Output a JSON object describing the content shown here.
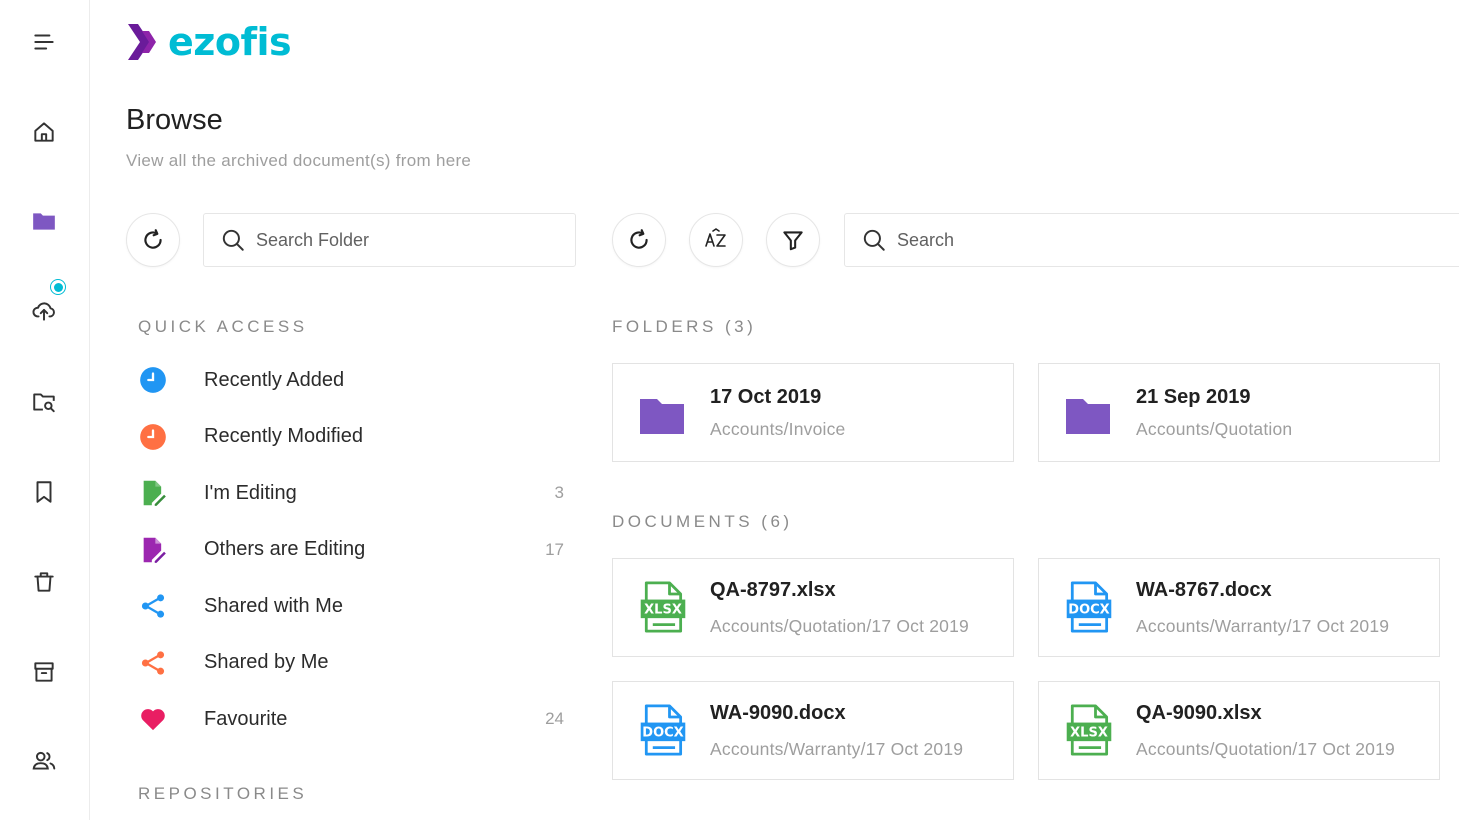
{
  "brand": {
    "logo_text": "ezofis"
  },
  "page": {
    "title": "Browse",
    "subtitle": "View all the archived document(s) from here"
  },
  "folder_search": {
    "placeholder": "Search Folder"
  },
  "main_search": {
    "placeholder": "Search"
  },
  "quick_access": {
    "heading": "QUICK ACCESS",
    "items": [
      {
        "label": "Recently Added",
        "count": "",
        "icon": "clock-icon",
        "color": "#2196f3"
      },
      {
        "label": "Recently Modified",
        "count": "",
        "icon": "clock-icon",
        "color": "#ff7043"
      },
      {
        "label": "I'm Editing",
        "count": "3",
        "icon": "edit-document-icon",
        "color": "#4caf50"
      },
      {
        "label": "Others are Editing",
        "count": "17",
        "icon": "edit-document-icon",
        "color": "#9c27b0"
      },
      {
        "label": "Shared with Me",
        "count": "",
        "icon": "share-icon",
        "color": "#2196f3"
      },
      {
        "label": "Shared by Me",
        "count": "",
        "icon": "share-icon",
        "color": "#ff7043"
      },
      {
        "label": "Favourite",
        "count": "24",
        "icon": "heart-icon",
        "color": "#e91e63"
      }
    ]
  },
  "repositories": {
    "heading": "REPOSITORIES"
  },
  "folders": {
    "heading": "FOLDERS (3)",
    "items": [
      {
        "name": "17 Oct 2019",
        "path": "Accounts/Invoice"
      },
      {
        "name": "21 Sep 2019",
        "path": "Accounts/Quotation"
      }
    ]
  },
  "documents": {
    "heading": "DOCUMENTS (6)",
    "items": [
      {
        "name": "QA-8797.xlsx",
        "path": "Accounts/Quotation/17 Oct 2019",
        "type": "XLSX"
      },
      {
        "name": "WA-8767.docx",
        "path": "Accounts/Warranty/17 Oct 2019",
        "type": "DOCX"
      },
      {
        "name": "WA-9090.docx",
        "path": "Accounts/Warranty/17 Oct 2019",
        "type": "DOCX"
      },
      {
        "name": "QA-9090.xlsx",
        "path": "Accounts/Quotation/17 Oct 2019",
        "type": "XLSX"
      }
    ]
  },
  "colors": {
    "folder": "#7e57c2",
    "accent": "#00bcd4",
    "logo_chevron": "#6a1b9a",
    "xlsx": "#4caf50",
    "docx": "#2196f3"
  }
}
